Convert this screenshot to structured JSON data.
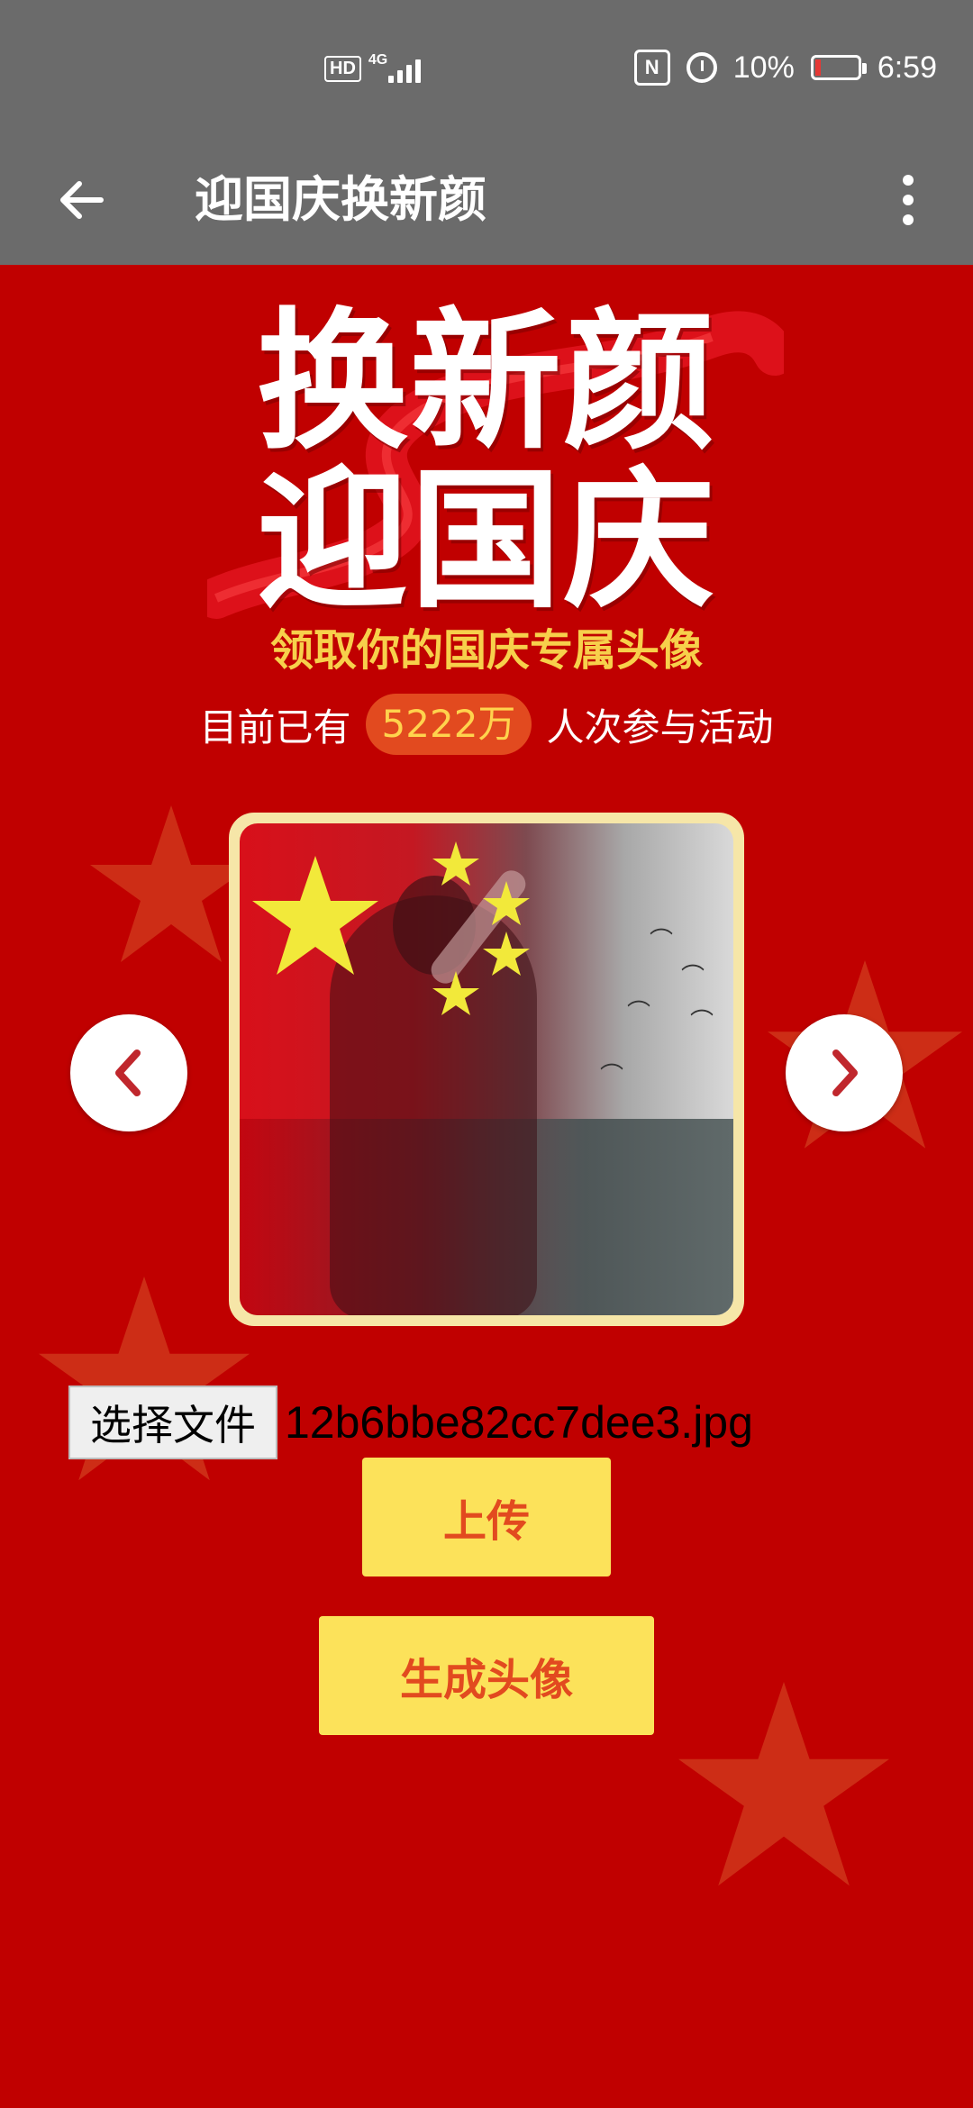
{
  "status_bar": {
    "network_badge": "HD",
    "network_type": "4G",
    "battery_percent": "10%",
    "time": "6:59",
    "icons": [
      "nfc-icon",
      "alarm-icon",
      "battery-icon"
    ]
  },
  "app_bar": {
    "title": "迎国庆换新颜",
    "back_icon": "arrow-left-icon",
    "more_icon": "more-vertical-icon"
  },
  "hero": {
    "line1": "换新颜",
    "line2": "迎国庆",
    "subtitle": "领取你的国庆专属头像"
  },
  "stats": {
    "prefix": "目前已有",
    "count": "5222万",
    "suffix": "人次参与活动"
  },
  "avatar": {
    "prev_icon": "chevron-left-icon",
    "next_icon": "chevron-right-icon"
  },
  "file_picker": {
    "button_label": "选择文件",
    "file_name": "12b6bbe82cc7dee3.jpg"
  },
  "actions": {
    "upload_label": "上传",
    "generate_label": "生成头像"
  },
  "colors": {
    "background": "#c00000",
    "toolbar": "#6b6b6b",
    "button_bg": "#fce25a",
    "button_text": "#e24a1f",
    "accent_gold": "#f7d04b"
  }
}
